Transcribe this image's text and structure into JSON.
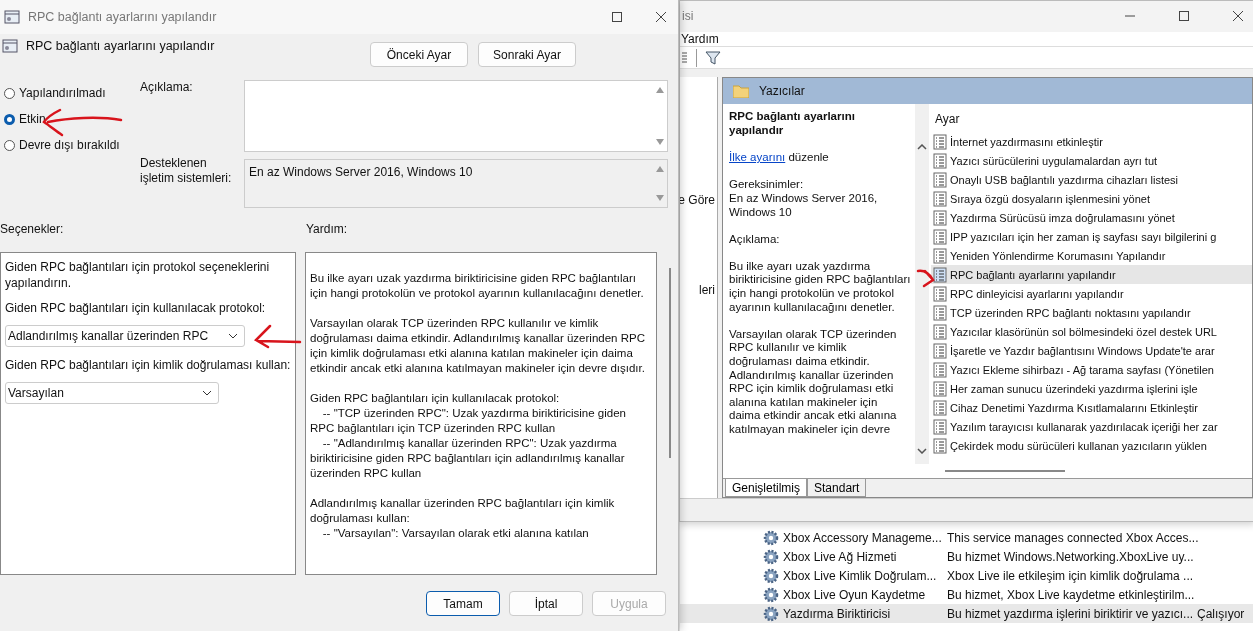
{
  "dialog": {
    "title": "RPC bağlantı ayarlarını yapılandır",
    "header_title": "RPC bağlantı ayarlarını yapılandır",
    "nav_buttons": [
      "Önceki Ayar",
      "Sonraki Ayar"
    ],
    "states": [
      {
        "label": "Yapılandırılmadı",
        "selected": false
      },
      {
        "label": "Etkin",
        "selected": true
      },
      {
        "label": "Devre dışı bırakıldı",
        "selected": false
      }
    ],
    "comment_label": "Açıklama:",
    "supported_label": "Desteklenen işletim sistemleri:",
    "supported_value": "En az Windows Server 2016, Windows 10",
    "options_label": "Seçenekler:",
    "help_label": "Yardım:",
    "options": [
      {
        "kind": "text",
        "text": "Giden RPC bağlantıları için protokol seçeneklerini yapılandırın."
      },
      {
        "kind": "text",
        "text": "Giden RPC bağlantıları için kullanılacak protokol:"
      },
      {
        "kind": "dropdown",
        "value": "Adlandırılmış kanallar üzerinden RPC"
      },
      {
        "kind": "text",
        "text": "Giden RPC bağlantıları için kimlik doğrulaması kullan:"
      },
      {
        "kind": "dropdown",
        "value": "Varsayılan"
      }
    ],
    "help": [
      "Bu ilke ayarı uzak yazdırma biriktiricisine giden RPC bağlantıları için hangi protokolün ve protokol ayarının kullanılacağını denetler.",
      "Varsayılan olarak TCP üzerinden RPC kullanılır ve kimlik doğrulaması daima etkindir. Adlandırılmış kanallar üzerinden RPC için kimlik doğrulaması etki alanına katılan makineler için daima etkindir ancak etki alanına katılmayan makineler için devre dışıdır.",
      "Giden RPC bağlantıları için kullanılacak protokol:\n    -- \"TCP üzerinden RPC\": Uzak yazdırma biriktiricisine giden RPC bağlantıları için TCP üzerinden RPC kullan\n    -- \"Adlandırılmış kanallar üzerinden RPC\": Uzak yazdırma biriktiricisine giden RPC bağlantıları için adlandırılmış kanallar üzerinden RPC kullan",
      "Adlandırılmış kanallar üzerinden RPC bağlantıları için kimlik doğrulaması kullan:\n    -- \"Varsayılan\": Varsayılan olarak etki alanına katılan"
    ],
    "buttons": [
      {
        "label": "Tamam",
        "default": true,
        "disabled": false
      },
      {
        "label": "İptal",
        "default": false,
        "disabled": false
      },
      {
        "label": "Uygula",
        "default": false,
        "disabled": true
      }
    ]
  },
  "editor_window": {
    "title_fragment": "isi",
    "menu": [
      "Yardım"
    ],
    "tree_fragments": [
      "e Göre",
      "leri"
    ],
    "folder": "Yazıcılar",
    "detail": {
      "title": "RPC bağlantı ayarlarını yapılandır",
      "link": "İlke ayarını",
      "link_rest": "düzenle",
      "requirements_label": "Gereksinimler:",
      "requirements": "En az Windows Server 2016, Windows 10",
      "description_label": "Açıklama:",
      "description": [
        "Bu ilke ayarı uzak yazdırma biriktiricisine giden RPC bağlantıları için hangi protokolün ve protokol ayarının kullanılacağını denetler.",
        "Varsayılan olarak TCP üzerinden RPC kullanılır ve kimlik doğrulaması daima etkindir. Adlandırılmış kanallar üzerinden RPC için kimlik doğrulaması etki alanına katılan makineler için daima etkindir ancak etki alanına katılmayan makineler için devre"
      ]
    },
    "list_header": "Ayar",
    "settings": [
      {
        "label": "İnternet yazdırmasını etkinleştir",
        "selected": false
      },
      {
        "label": "Yazıcı sürücülerini uygulamalardan ayrı tut",
        "selected": false
      },
      {
        "label": "Onaylı USB bağlantılı yazdırma cihazları listesi",
        "selected": false
      },
      {
        "label": "Sıraya özgü dosyaların işlenmesini yönet",
        "selected": false
      },
      {
        "label": "Yazdırma Sürücüsü imza doğrulamasını yönet",
        "selected": false
      },
      {
        "label": "IPP yazıcıları için her zaman iş sayfası sayı bilgilerini g",
        "selected": false
      },
      {
        "label": "Yeniden Yönlendirme Korumasını Yapılandır",
        "selected": false
      },
      {
        "label": "RPC bağlantı ayarlarını yapılandır",
        "selected": true
      },
      {
        "label": "RPC dinleyicisi ayarlarını yapılandır",
        "selected": false
      },
      {
        "label": "TCP üzerinden RPC bağlantı noktasını yapılandır",
        "selected": false
      },
      {
        "label": "Yazıcılar klasörünün sol bölmesindeki özel destek URL",
        "selected": false
      },
      {
        "label": "İşaretle ve Yazdır bağlantısını Windows Update'te arar",
        "selected": false
      },
      {
        "label": "Yazıcı Ekleme sihirbazı - Ağ tarama sayfası (Yönetilen",
        "selected": false
      },
      {
        "label": "Her zaman sunucu üzerindeki yazdırma işlerini işle",
        "selected": false
      },
      {
        "label": "Cihaz Denetimi Yazdırma Kısıtlamalarını Etkinleştir",
        "selected": false
      },
      {
        "label": "Yazılım tarayıcısı kullanarak yazdırılacak içeriği her zar",
        "selected": false
      },
      {
        "label": "Çekirdek modu sürücüleri kullanan yazıcıların yüklen",
        "selected": false
      }
    ],
    "tabs": [
      {
        "label": "Genişletilmiş",
        "selected": true
      },
      {
        "label": "Standart",
        "selected": false
      }
    ]
  },
  "services": [
    {
      "name": "Xbox Accessory Manageme...",
      "description": "This service manages connected Xbox Acces...",
      "selected": false
    },
    {
      "name": "Xbox Live Ağ Hizmeti",
      "description": "Bu hizmet Windows.Networking.XboxLive uy...",
      "selected": false
    },
    {
      "name": "Xbox Live Kimlik Doğrulam...",
      "description": "Xbox Live ile etkileşim için kimlik doğrulama ...",
      "selected": false
    },
    {
      "name": "Xbox Live Oyun Kaydetme",
      "description": "Bu hizmet, Xbox Live kaydetme etkinleştirilm...",
      "selected": false
    },
    {
      "name": "Yazdırma Biriktiricisi",
      "description": "Bu hizmet yazdırma işlerini biriktirir ve yazıcı...",
      "status": "Çalışıyor",
      "selected": true
    }
  ]
}
